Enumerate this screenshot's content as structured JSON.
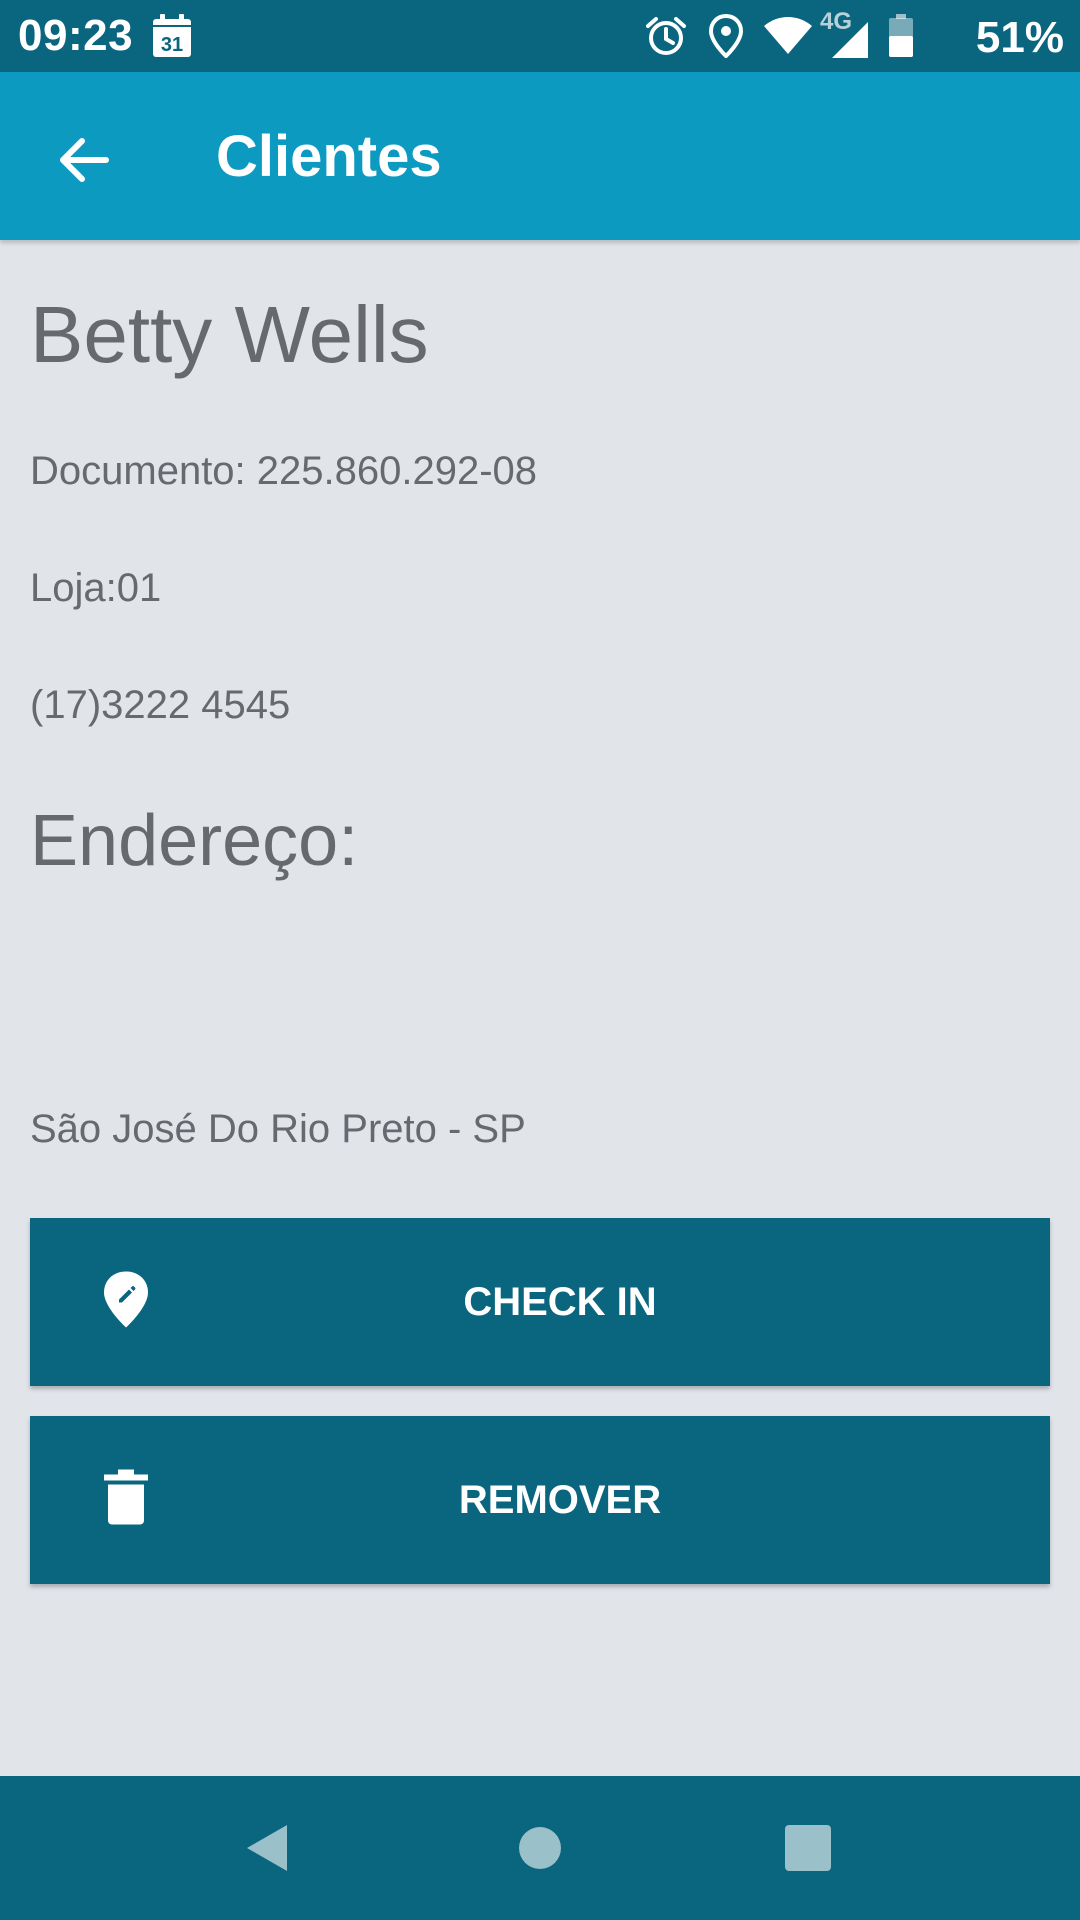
{
  "status_bar": {
    "time": "09:23",
    "calendar_day": "31",
    "network_type": "4G",
    "battery": "51%",
    "icons": [
      "calendar-icon",
      "alarm-icon",
      "location-icon",
      "wifi-icon",
      "signal-icon",
      "battery-icon"
    ]
  },
  "app_bar": {
    "title": "Clientes",
    "back_icon": "arrow-back-icon"
  },
  "client": {
    "name": "Betty Wells",
    "document": "Documento: 225.860.292-08",
    "store": "Loja:01",
    "phone": "(17)3222 4545",
    "address_heading": "Endereço:",
    "city": "São José Do Rio Preto - SP"
  },
  "actions": {
    "checkin_label": "CHECK IN",
    "checkin_icon": "map-pin-edit-icon",
    "remove_label": "REMOVER",
    "remove_icon": "trash-icon"
  },
  "nav_bar": {
    "icons": [
      "nav-back-icon",
      "nav-home-icon",
      "nav-recents-icon"
    ]
  },
  "colors": {
    "status_bar": "#0a657f",
    "app_bar": "#0d9ac1",
    "background": "#e1e5ea",
    "button": "#0a657f",
    "text": "#66696d"
  }
}
